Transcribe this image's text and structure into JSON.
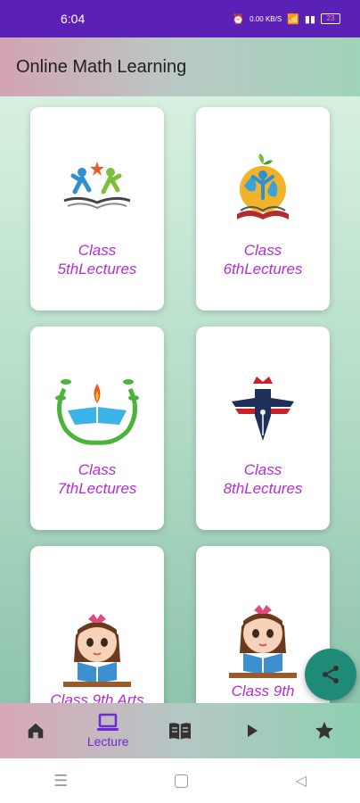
{
  "status_bar": {
    "time": "6:04",
    "net_speed": "0.00 KB/S",
    "battery": "23"
  },
  "app_bar": {
    "title": "Online Math Learning"
  },
  "cards": [
    {
      "label": "Class 5thLectures",
      "icon": "teamwork-book-icon"
    },
    {
      "label": "Class 6thLectures",
      "icon": "globe-book-icon"
    },
    {
      "label": "Class 7thLectures",
      "icon": "open-book-flame-icon"
    },
    {
      "label": "Class 8thLectures",
      "icon": "pen-crown-icon"
    },
    {
      "label": "Class 9th Arts",
      "icon": "girl-reading-icon"
    },
    {
      "label": "Class 9th",
      "icon": "girl-reading-icon"
    }
  ],
  "bottom_nav": {
    "items": [
      {
        "name": "home",
        "icon": "home-icon",
        "label": ""
      },
      {
        "name": "lecture",
        "icon": "laptop-icon",
        "label": "Lecture"
      },
      {
        "name": "book",
        "icon": "book-icon",
        "label": ""
      },
      {
        "name": "play",
        "icon": "play-icon",
        "label": ""
      },
      {
        "name": "star",
        "icon": "star-icon",
        "label": ""
      }
    ]
  },
  "colors": {
    "status_bar": "#5b21b6",
    "card_label": "#b32dd1",
    "fab": "#1f8a78",
    "active_nav": "#6d28d9"
  }
}
